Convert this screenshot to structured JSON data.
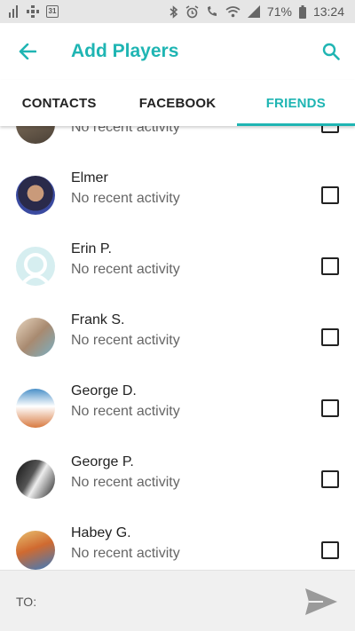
{
  "status_bar": {
    "calendar_day": "31",
    "battery": "71%",
    "time": "13:24",
    "icons": [
      "signal-icon",
      "grid-icon",
      "calendar-icon",
      "bluetooth-icon",
      "alarm-icon",
      "call-icon",
      "wifi-icon",
      "cell-signal-icon",
      "battery-icon"
    ]
  },
  "header": {
    "title": "Add Players",
    "back_icon": "arrow-left-icon",
    "search_icon": "search-icon",
    "accent": "#1fb5b3"
  },
  "tabs": [
    {
      "label": "CONTACTS",
      "active": false
    },
    {
      "label": "FACEBOOK",
      "active": false
    },
    {
      "label": "FRIENDS",
      "active": true
    }
  ],
  "friends": [
    {
      "name": "",
      "activity": "No recent activity",
      "checked": false
    },
    {
      "name": "Elmer",
      "activity": "No recent activity",
      "checked": false
    },
    {
      "name": "Erin P.",
      "activity": "No recent activity",
      "checked": false
    },
    {
      "name": "Frank S.",
      "activity": "No recent activity",
      "checked": false
    },
    {
      "name": "George D.",
      "activity": "No recent activity",
      "checked": false
    },
    {
      "name": "George P.",
      "activity": "No recent activity",
      "checked": false
    },
    {
      "name": "Habey G.",
      "activity": "No recent activity",
      "checked": false
    }
  ],
  "compose": {
    "to_label": "TO:",
    "send_icon": "send-icon"
  }
}
